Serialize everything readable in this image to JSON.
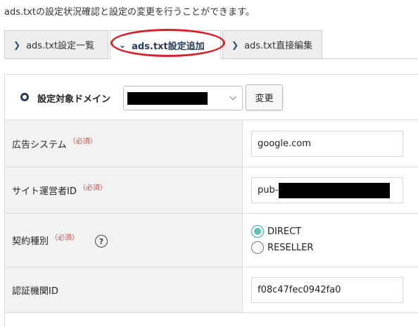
{
  "intro_text": "ads.txtの設定状況確認と設定の変更を行うことができます。",
  "tabs": [
    {
      "label": "ads.txt設定一覧",
      "icon": "chevron-right-icon",
      "active": false
    },
    {
      "label": "ads.txt設定追加",
      "icon": "chevron-down-icon",
      "active": true
    },
    {
      "label": "ads.txt直接編集",
      "icon": "chevron-right-icon",
      "active": false
    }
  ],
  "domain": {
    "label": "設定対象ドメイン",
    "button_label": "変更"
  },
  "fields": {
    "ad_system": {
      "label": "広告システム",
      "required": "（必須）",
      "value": "google.com"
    },
    "publisher_id": {
      "label": "サイト運営者ID",
      "required": "（必須）",
      "value": "pub-"
    },
    "contract_type": {
      "label": "契約種別",
      "required": "（必須）",
      "help": "?",
      "options": [
        {
          "label": "DIRECT",
          "selected": true
        },
        {
          "label": "RESELLER",
          "selected": false
        }
      ]
    },
    "cert_authority": {
      "label": "認証機関ID",
      "value": "f08c47fec0942fa0"
    }
  },
  "colors": {
    "highlight_ring": "#d8212b",
    "required_text": "#c0504d",
    "radio_checked": "#5fc1b9",
    "active_tab_text": "#233a58"
  }
}
